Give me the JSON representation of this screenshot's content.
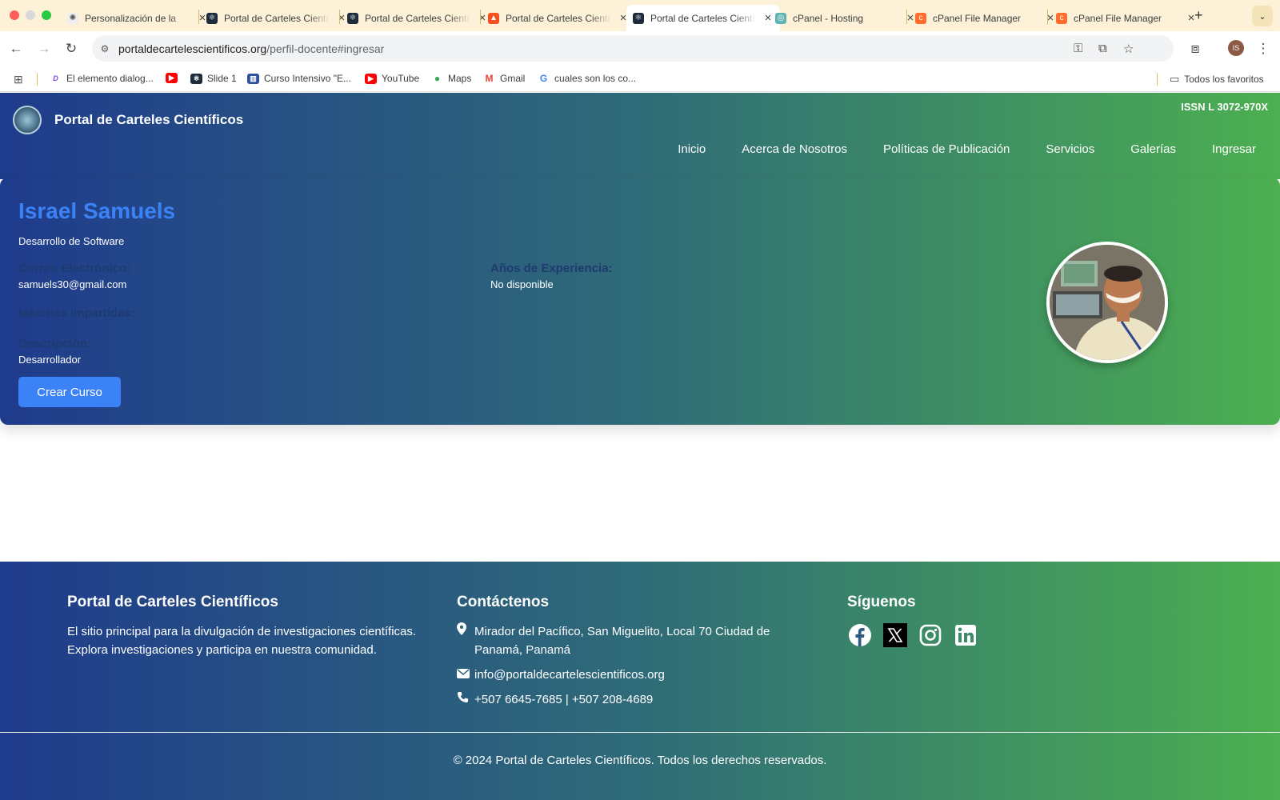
{
  "browser": {
    "tabs": [
      {
        "title": "Personalización de la",
        "active": false
      },
      {
        "title": "Portal de Carteles Científicos",
        "active": false
      },
      {
        "title": "Portal de Carteles Científicos",
        "active": false
      },
      {
        "title": "Portal de Carteles Científicos",
        "active": false
      },
      {
        "title": "Portal de Carteles Científicos",
        "active": true
      },
      {
        "title": "cPanel - Hosting",
        "active": false
      },
      {
        "title": "cPanel File Manager",
        "active": false
      },
      {
        "title": "cPanel File Manager",
        "active": false
      }
    ],
    "url_host": "portaldecartelescientificos.org",
    "url_path": "/perfil-docente#ingresar",
    "profile_initials": "IS",
    "bookmarks": [
      {
        "label": "El elemento dialog..."
      },
      {
        "label": ""
      },
      {
        "label": "Slide 1"
      },
      {
        "label": "Curso Intensivo \"E..."
      },
      {
        "label": "YouTube"
      },
      {
        "label": "Maps"
      },
      {
        "label": "Gmail"
      },
      {
        "label": "cuales son los co..."
      }
    ],
    "all_bookmarks_label": "Todos los favoritos"
  },
  "site": {
    "title": "Portal de Carteles Científicos",
    "issn": "ISSN L 3072-970X",
    "nav": [
      "Inicio",
      "Acerca de Nosotros",
      "Políticas de Publicación",
      "Servicios",
      "Galerías",
      "Ingresar"
    ]
  },
  "profile": {
    "name": "Israel Samuels",
    "role": "Desarrollo de Software",
    "email_label": "Correo Electrónico:",
    "email": "samuels30@gmail.com",
    "experience_label": "Años de Experiencia:",
    "experience": "No disponible",
    "subjects_label": "Materias Impartidas:",
    "description_label": "Descripción:",
    "description": "Desarrollador",
    "create_course_button": "Crear Curso"
  },
  "footer": {
    "about_heading": "Portal de Carteles Científicos",
    "about_text": "El sitio principal para la divulgación de investigaciones científicas. Explora investigaciones y participa en nuestra comunidad.",
    "contact_heading": "Contáctenos",
    "address": "Mirador del Pacífico, San Miguelito, Local 70 Ciudad de Panamá, Panamá",
    "email": "info@portaldecartelescientificos.org",
    "phone": "+507 6645-7685 | +507 208-4689",
    "follow_heading": "Síguenos",
    "social": [
      "facebook-icon",
      "x-icon",
      "instagram-icon",
      "linkedin-icon"
    ],
    "copyright": "© 2024 Portal de Carteles Científicos. Todos los derechos reservados."
  },
  "colors": {
    "gradient_start": "#1f3b8c",
    "gradient_end": "#4caf50",
    "name_accent": "#3b82f6",
    "label_color": "#1e3a6e"
  }
}
